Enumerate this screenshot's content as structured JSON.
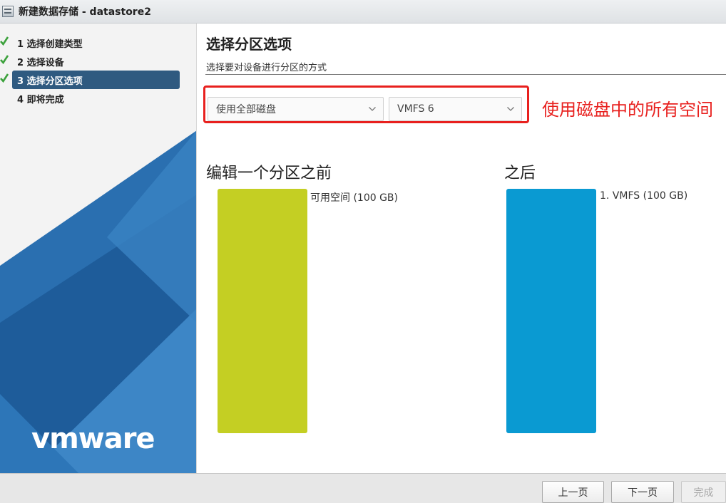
{
  "window": {
    "title": "新建数据存储 - datastore2"
  },
  "sidebar": {
    "steps": [
      {
        "label": "1 选择创建类型",
        "done": true
      },
      {
        "label": "2 选择设备",
        "done": true
      },
      {
        "label": "3 选择分区选项",
        "done": true,
        "active": true
      },
      {
        "label": "4 即将完成",
        "done": false
      }
    ],
    "logo": "vmware"
  },
  "main": {
    "title": "选择分区选项",
    "subtitle": "选择要对设备进行分区的方式",
    "partition_select": {
      "value": "使用全部磁盘"
    },
    "vmfs_select": {
      "value": "VMFS 6"
    },
    "annotation": "使用磁盘中的所有空间",
    "before": {
      "title": "编辑一个分区之前",
      "label": "可用空间  (100 GB)"
    },
    "after": {
      "title": "之后",
      "label": "1. VMFS  (100 GB)"
    }
  },
  "footer": {
    "prev": "上一页",
    "next": "下一页",
    "finish": "完成"
  },
  "colors": {
    "accent": "#2f5a80",
    "free_space": "#c4cf23",
    "vmfs": "#0a9ad2",
    "annotation": "#e8201e",
    "check": "#3ba13b"
  }
}
